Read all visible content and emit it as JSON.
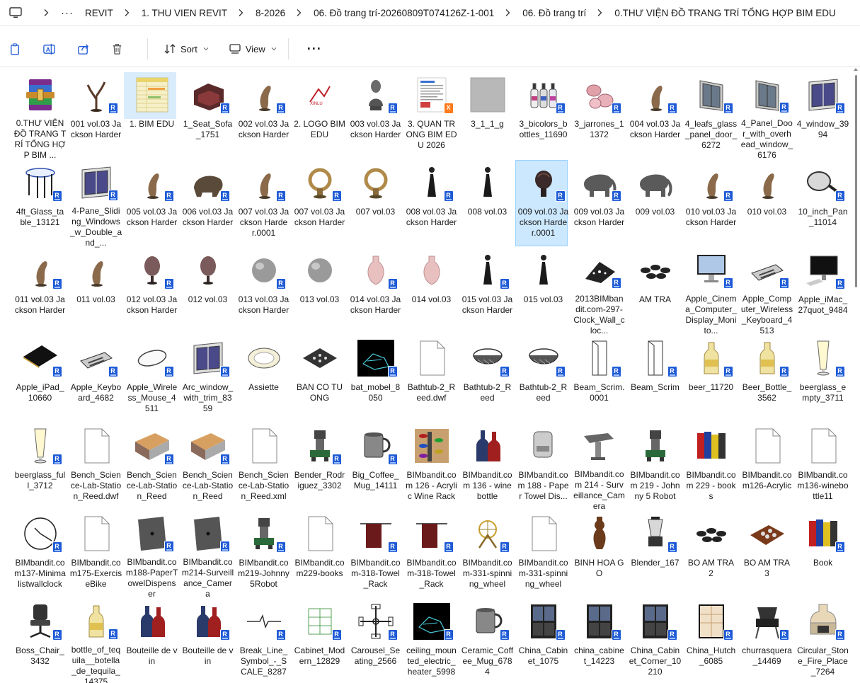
{
  "breadcrumb": [
    "REVIT",
    "1. THU VIEN REVIT",
    "8-2026",
    "06. Đồ trang trí-20260809T074126Z-1-001",
    "06. Đồ trang trí",
    "0.THƯ VIỆN ĐỒ TRANG TRÍ TỔNG HỢP BIM EDU"
  ],
  "toolbar": {
    "sort_label": "Sort",
    "view_label": "View"
  },
  "colors": {
    "accent": "#1f5bd6",
    "selection": "#cce8ff",
    "selection_border": "#99d1ff"
  },
  "items": [
    {
      "name": "0.THƯ VIỆN ĐỒ TRANG TRÍ TỔNG HỢP BIM ...",
      "icon": "winrar-archive-icon",
      "badge": ""
    },
    {
      "name": "001 vol.03 Jackson Harder",
      "icon": "tree-sculpture-icon",
      "badge": "R"
    },
    {
      "name": "1. BIM EDU",
      "icon": "spreadsheet-icon",
      "badge": "",
      "state": "hover"
    },
    {
      "name": "1_Seat_Sofa_1751",
      "icon": "sofa-icon",
      "badge": "R"
    },
    {
      "name": "002 vol.03 Jackson Harder",
      "icon": "sculpture-icon",
      "badge": "R"
    },
    {
      "name": "2. LOGO BIM EDU",
      "icon": "logo-image-icon",
      "badge": ""
    },
    {
      "name": "003 vol.03 Jackson Harder",
      "icon": "bust-icon",
      "badge": "R"
    },
    {
      "name": "3. QUAN TRONG BIM EDU 2026",
      "icon": "document-image-icon",
      "badge": "X"
    },
    {
      "name": "3_1_1_g",
      "icon": "texture-icon",
      "badge": ""
    },
    {
      "name": "3_bicolors_bottles_11690",
      "icon": "bottles-icon",
      "badge": "R"
    },
    {
      "name": "3_jarrones_11372",
      "icon": "vases-icon",
      "badge": "R"
    },
    {
      "name": "004 vol.03 Jackson Harder",
      "icon": "sculpture-icon",
      "badge": "R"
    },
    {
      "name": "4_leafs_glass_panel_door_6272",
      "icon": "door-icon",
      "badge": "R"
    },
    {
      "name": "4_Panel_Door_with_overhead_window_6176",
      "icon": "door-icon",
      "badge": "R"
    },
    {
      "name": "4_window_3994",
      "icon": "window-icon",
      "badge": "R"
    },
    {
      "name": "4ft_Glass_table_13121",
      "icon": "table-icon",
      "badge": "R"
    },
    {
      "name": "4-Pane_Sliding_Windows_w_Double_and_...",
      "icon": "window-icon",
      "badge": "R"
    },
    {
      "name": "005 vol.03 Jackson Harder",
      "icon": "sculpture-icon",
      "badge": "R"
    },
    {
      "name": "006 vol.03 Jackson Harder",
      "icon": "animal-sculpture-icon",
      "badge": "R"
    },
    {
      "name": "007 vol.03 Jackson Harder.0001",
      "icon": "sculpture-icon",
      "badge": "R"
    },
    {
      "name": "007 vol.03 Jackson Harder",
      "icon": "ring-sculpture-icon",
      "badge": "R"
    },
    {
      "name": "007 vol.03",
      "icon": "ring-sculpture-icon",
      "badge": ""
    },
    {
      "name": "008 vol.03 Jackson Harder",
      "icon": "figure-icon",
      "badge": "R"
    },
    {
      "name": "008 vol.03",
      "icon": "figure-icon",
      "badge": ""
    },
    {
      "name": "009 vol.03 Jackson Harder.0001",
      "icon": "head-sculpture-icon",
      "badge": "R",
      "state": "selected"
    },
    {
      "name": "009 vol.03 Jackson Harder",
      "icon": "elephant-icon",
      "badge": "R"
    },
    {
      "name": "009 vol.03",
      "icon": "elephant-icon",
      "badge": ""
    },
    {
      "name": "010 vol.03 Jackson Harder",
      "icon": "sculpture-icon",
      "badge": "R"
    },
    {
      "name": "010 vol.03",
      "icon": "sculpture-icon",
      "badge": ""
    },
    {
      "name": "10_inch_Pan_11014",
      "icon": "pan-icon",
      "badge": "R"
    },
    {
      "name": "011 vol.03 Jackson Harder",
      "icon": "sculpture-icon",
      "badge": "R"
    },
    {
      "name": "011 vol.03",
      "icon": "sculpture-icon",
      "badge": ""
    },
    {
      "name": "012 vol.03 Jackson Harder",
      "icon": "egg-vase-icon",
      "badge": "R"
    },
    {
      "name": "012 vol.03",
      "icon": "egg-vase-icon",
      "badge": ""
    },
    {
      "name": "013 vol.03 Jackson Harder",
      "icon": "round-vase-icon",
      "badge": "R"
    },
    {
      "name": "013 vol.03",
      "icon": "round-vase-icon",
      "badge": ""
    },
    {
      "name": "014 vol.03 Jackson Harder",
      "icon": "vase-icon",
      "badge": "R"
    },
    {
      "name": "014 vol.03",
      "icon": "vase-icon",
      "badge": ""
    },
    {
      "name": "015 vol.03 Jackson Harder",
      "icon": "figure-icon",
      "badge": "R"
    },
    {
      "name": "015 vol.03",
      "icon": "figure-icon",
      "badge": ""
    },
    {
      "name": "2013BIMbandit.com-297-Clock_Wall_cloc...",
      "icon": "clock-cad-icon",
      "badge": "R"
    },
    {
      "name": "AM TRA",
      "icon": "teacups-icon",
      "badge": ""
    },
    {
      "name": "Apple_Cinema_Computer_Display_Monito...",
      "icon": "monitor-icon",
      "badge": "R"
    },
    {
      "name": "Apple_Computer_Wireless_Keyboard_4513",
      "icon": "keyboard-icon",
      "badge": "R"
    },
    {
      "name": "Apple_iMac_27quot_9484",
      "icon": "imac-icon",
      "badge": "R"
    },
    {
      "name": "Apple_iPad_10660",
      "icon": "tablet-icon",
      "badge": "R"
    },
    {
      "name": "Apple_Keyboard_4682",
      "icon": "keyboard-icon",
      "badge": "R"
    },
    {
      "name": "Apple_Wireless_Mouse_4511",
      "icon": "mouse-icon",
      "badge": "R"
    },
    {
      "name": "Arc_window_with_trim_8359",
      "icon": "window-icon",
      "badge": "R"
    },
    {
      "name": "Assiette",
      "icon": "plate-icon",
      "badge": ""
    },
    {
      "name": "BAN CO TUONG",
      "icon": "board-icon",
      "badge": ""
    },
    {
      "name": "bat_mobel_8050",
      "icon": "cad-dark-icon",
      "badge": "R"
    },
    {
      "name": "Bathtub-2_Reed.dwf",
      "icon": "blank-file-icon",
      "badge": ""
    },
    {
      "name": "Bathtub-2_Reed",
      "icon": "basket-icon",
      "badge": "R"
    },
    {
      "name": "Bathtub-2_Reed",
      "icon": "basket-icon",
      "badge": "R"
    },
    {
      "name": "Beam_Scrim.0001",
      "icon": "beam-icon",
      "badge": "R"
    },
    {
      "name": "Beam_Scrim",
      "icon": "beam-icon",
      "badge": "R"
    },
    {
      "name": "beer_11720",
      "icon": "bottle-icon",
      "badge": "R"
    },
    {
      "name": "Beer_Bottle_3562",
      "icon": "bottle-icon",
      "badge": "R"
    },
    {
      "name": "beerglass_empty_3711",
      "icon": "glass-icon",
      "badge": "R"
    },
    {
      "name": "beerglass_full_3712",
      "icon": "glass-icon",
      "badge": "R"
    },
    {
      "name": "Bench_Science-Lab-Station_Reed.dwf",
      "icon": "blank-file-icon",
      "badge": ""
    },
    {
      "name": "Bench_Science-Lab-Station_Reed",
      "icon": "bench-icon",
      "badge": "R"
    },
    {
      "name": "Bench_Science-Lab-Station_Reed",
      "icon": "bench-icon",
      "badge": "R"
    },
    {
      "name": "Bench_Science-Lab-Station_Reed.xml",
      "icon": "blank-file-icon",
      "badge": ""
    },
    {
      "name": "Bender_Rodriguez_3302",
      "icon": "robot-icon",
      "badge": "R"
    },
    {
      "name": "Big_Coffee_Mug_14111",
      "icon": "mug-icon",
      "badge": "R"
    },
    {
      "name": "BIMbandit.com 126 - Acrylic Wine Rack",
      "icon": "wine-rack-icon",
      "badge": ""
    },
    {
      "name": "BIMbandit.com 136 - wine bottle",
      "icon": "wine-bottle-icon",
      "badge": ""
    },
    {
      "name": "BIMbandit.com 188 - Paper Towel Dis...",
      "icon": "dispenser-icon",
      "badge": ""
    },
    {
      "name": "BIMbandit.com 214 - Surveillance_Camera",
      "icon": "camera-icon",
      "badge": ""
    },
    {
      "name": "BIMbandit.com 219 - Johnny 5 Robot",
      "icon": "robot-icon",
      "badge": ""
    },
    {
      "name": "BIMbandit.com 229 - books",
      "icon": "books-icon",
      "badge": ""
    },
    {
      "name": "BIMbandit.com126-Acrylic",
      "icon": "blank-file-icon",
      "badge": ""
    },
    {
      "name": "BIMbandit.com136-winebottle11",
      "icon": "blank-file-icon",
      "badge": ""
    },
    {
      "name": "BIMbandit.com137-Minimalistwallclock",
      "icon": "wall-clock-icon",
      "badge": "R"
    },
    {
      "name": "BIMbandit.com175-ExerciseBike",
      "icon": "blank-file-icon",
      "badge": ""
    },
    {
      "name": "BIMbandit.com188-PaperTowelDispenser",
      "icon": "panel-icon",
      "badge": "R"
    },
    {
      "name": "BIMbandit.com214-Surveillance_Camera",
      "icon": "panel-icon",
      "badge": "R"
    },
    {
      "name": "BIMbandit.com219-Johnny5Robot",
      "icon": "robot-icon",
      "badge": "R"
    },
    {
      "name": "BIMbandit.com229-books",
      "icon": "blank-file-icon",
      "badge": ""
    },
    {
      "name": "BIMbandit.com-318-Towel_Rack",
      "icon": "towel-rack-icon",
      "badge": "R"
    },
    {
      "name": "BIMbandit.com-318-Towel_Rack",
      "icon": "towel-rack-icon",
      "badge": "R"
    },
    {
      "name": "BIMbandit.com-331-spinning_wheel",
      "icon": "spinning-wheel-icon",
      "badge": "R"
    },
    {
      "name": "BIMbandit.com-331-spinning_wheel",
      "icon": "blank-file-icon",
      "badge": ""
    },
    {
      "name": "BINH HOA GO",
      "icon": "wood-vase-icon",
      "badge": ""
    },
    {
      "name": "Blender_167",
      "icon": "blender-icon",
      "badge": "R"
    },
    {
      "name": "BO AM TRA 2",
      "icon": "teacups-icon",
      "badge": ""
    },
    {
      "name": "BO AM TRA 3",
      "icon": "tea-tray-icon",
      "badge": ""
    },
    {
      "name": "Book",
      "icon": "books-icon",
      "badge": "R"
    },
    {
      "name": "Boss_Chair_3432",
      "icon": "chair-icon",
      "badge": "R"
    },
    {
      "name": "bottle_of_tequila__botella_de_tequila_14375",
      "icon": "bottle-icon",
      "badge": "R"
    },
    {
      "name": "Bouteille de vin",
      "icon": "wine-bottle-icon",
      "badge": ""
    },
    {
      "name": "Bouteille de vin",
      "icon": "wine-bottle-icon",
      "badge": "R"
    },
    {
      "name": "Break_Line_Symbol_-_SCALE_8287",
      "icon": "break-line-icon",
      "badge": "R"
    },
    {
      "name": "Cabinet_Modern_12829",
      "icon": "cabinet-cad-icon",
      "badge": "R"
    },
    {
      "name": "Carousel_Seating_2566",
      "icon": "seating-icon",
      "badge": "R"
    },
    {
      "name": "ceiling_mounted_electric_heater_5998",
      "icon": "cad-dark-icon",
      "badge": "R"
    },
    {
      "name": "Ceramic_Coffee_Mug_6784",
      "icon": "mug-icon",
      "badge": "R"
    },
    {
      "name": "China_Cabinet_1075",
      "icon": "cabinet-icon",
      "badge": "R"
    },
    {
      "name": "china_cabinet_14223",
      "icon": "cabinet-icon",
      "badge": "R"
    },
    {
      "name": "China_Cabinet_Corner_10210",
      "icon": "cabinet-icon",
      "badge": "R"
    },
    {
      "name": "China_Hutch_6085",
      "icon": "hutch-icon",
      "badge": "R"
    },
    {
      "name": "churrasquera_14469",
      "icon": "grill-icon",
      "badge": "R"
    },
    {
      "name": "Circular_Stone_Fire_Place_7264",
      "icon": "fireplace-icon",
      "badge": "R"
    }
  ]
}
